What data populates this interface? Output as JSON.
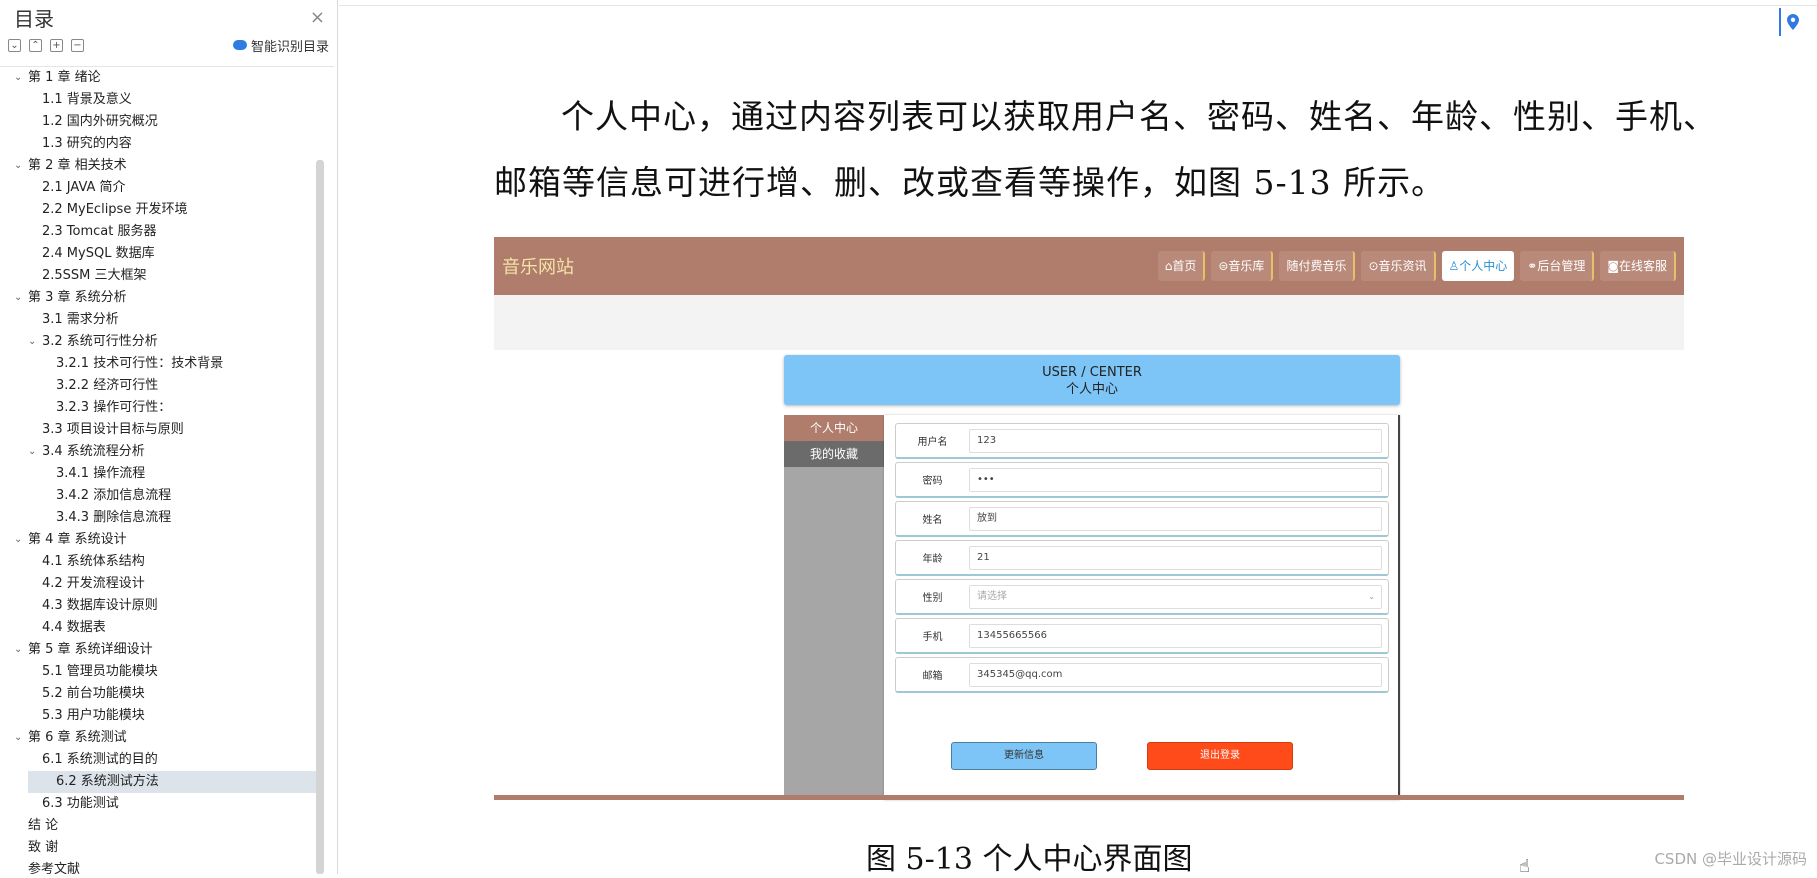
{
  "sidebar": {
    "title": "目录",
    "close_glyph": "×",
    "smart_label": "智能识别目录",
    "tools": [
      "⌄",
      "⌃",
      "+",
      "−"
    ],
    "items": [
      {
        "label": "第 1 章  绪论",
        "level": 0,
        "arrow": "⌄"
      },
      {
        "label": "1.1 背景及意义",
        "level": 1
      },
      {
        "label": "1.2  国内外研究概况",
        "level": 1
      },
      {
        "label": "1.3  研究的内容",
        "level": 1
      },
      {
        "label": "第 2 章  相关技术",
        "level": 0,
        "arrow": "⌄"
      },
      {
        "label": "2.1 JAVA 简介",
        "level": 1
      },
      {
        "label": "2.2 MyEclipse 开发环境",
        "level": 1
      },
      {
        "label": "2.3 Tomcat 服务器",
        "level": 1
      },
      {
        "label": "2.4 MySQL 数据库",
        "level": 1
      },
      {
        "label": "2.5SSM 三大框架",
        "level": 1
      },
      {
        "label": "第 3 章  系统分析",
        "level": 0,
        "arrow": "⌄"
      },
      {
        "label": "3.1  需求分析",
        "level": 1
      },
      {
        "label": "3.2  系统可行性分析",
        "level": 1,
        "arrow": "⌄"
      },
      {
        "label": "3.2.1 技术可行性：技术背景",
        "level": 2
      },
      {
        "label": "3.2.2 经济可行性",
        "level": 2
      },
      {
        "label": "3.2.3 操作可行性：",
        "level": 2
      },
      {
        "label": "3.3  项目设计目标与原则",
        "level": 1
      },
      {
        "label": "3.4 系统流程分析",
        "level": 1,
        "arrow": "⌄"
      },
      {
        "label": "3.4.1 操作流程",
        "level": 2
      },
      {
        "label": "3.4.2 添加信息流程",
        "level": 2
      },
      {
        "label": "3.4.3 删除信息流程",
        "level": 2
      },
      {
        "label": "第 4 章  系统设计",
        "level": 0,
        "arrow": "⌄"
      },
      {
        "label": "4.1  系统体系结构",
        "level": 1
      },
      {
        "label": "4.2 开发流程设计",
        "level": 1
      },
      {
        "label": "4.3  数据库设计原则",
        "level": 1
      },
      {
        "label": "4.4  数据表",
        "level": 1
      },
      {
        "label": "第 5 章  系统详细设计",
        "level": 0,
        "arrow": "⌄"
      },
      {
        "label": "5.1 管理员功能模块",
        "level": 1
      },
      {
        "label": "5.2 前台功能模块",
        "level": 1
      },
      {
        "label": "5.3 用户功能模块",
        "level": 1
      },
      {
        "label": "第 6 章    系统测试",
        "level": 0,
        "arrow": "⌄"
      },
      {
        "label": "6.1 系统测试的目的",
        "level": 1
      },
      {
        "label": "6.2 系统测试方法",
        "level": 1,
        "selected": true
      },
      {
        "label": "6.3 功能测试",
        "level": 1
      },
      {
        "label": "结    论",
        "level": 0
      },
      {
        "label": "致    谢",
        "level": 0
      },
      {
        "label": "参考文献",
        "level": 0
      }
    ]
  },
  "document": {
    "para_line1": "个人中心，通过内容列表可以获取用户名、密码、姓名、年龄、性别、手机、",
    "para_line2": "邮箱等信息可进行增、删、改或查看等操作，如图 5-13 所示。",
    "caption": "图 5-13 个人中心界面图",
    "watermark": "CSDN @毕业设计源码"
  },
  "figure": {
    "logo": "音乐网站",
    "nav": [
      {
        "label": "⌂首页"
      },
      {
        "label": "⊜音乐库"
      },
      {
        "label": "随付费音乐"
      },
      {
        "label": "⊙音乐资讯"
      },
      {
        "label": "♙个人中心",
        "active": true
      },
      {
        "label": "⚭后台管理"
      },
      {
        "label": "◙在线客服"
      }
    ],
    "card_en": "USER / CENTER",
    "card_cn": "个人中心",
    "side_items": [
      {
        "label": "个人中心",
        "active": true
      },
      {
        "label": "我的收藏"
      }
    ],
    "fields": [
      {
        "label": "用户名",
        "value": "123"
      },
      {
        "label": "密码",
        "value": "•••"
      },
      {
        "label": "姓名",
        "value": "放到"
      },
      {
        "label": "年龄",
        "value": "21"
      },
      {
        "label": "性别",
        "value": "请选择",
        "select": true
      },
      {
        "label": "手机",
        "value": "13455665566"
      },
      {
        "label": "邮箱",
        "value": "345345@qq.com"
      }
    ],
    "update_label": "更新信息",
    "logout_label": "退出登录"
  }
}
